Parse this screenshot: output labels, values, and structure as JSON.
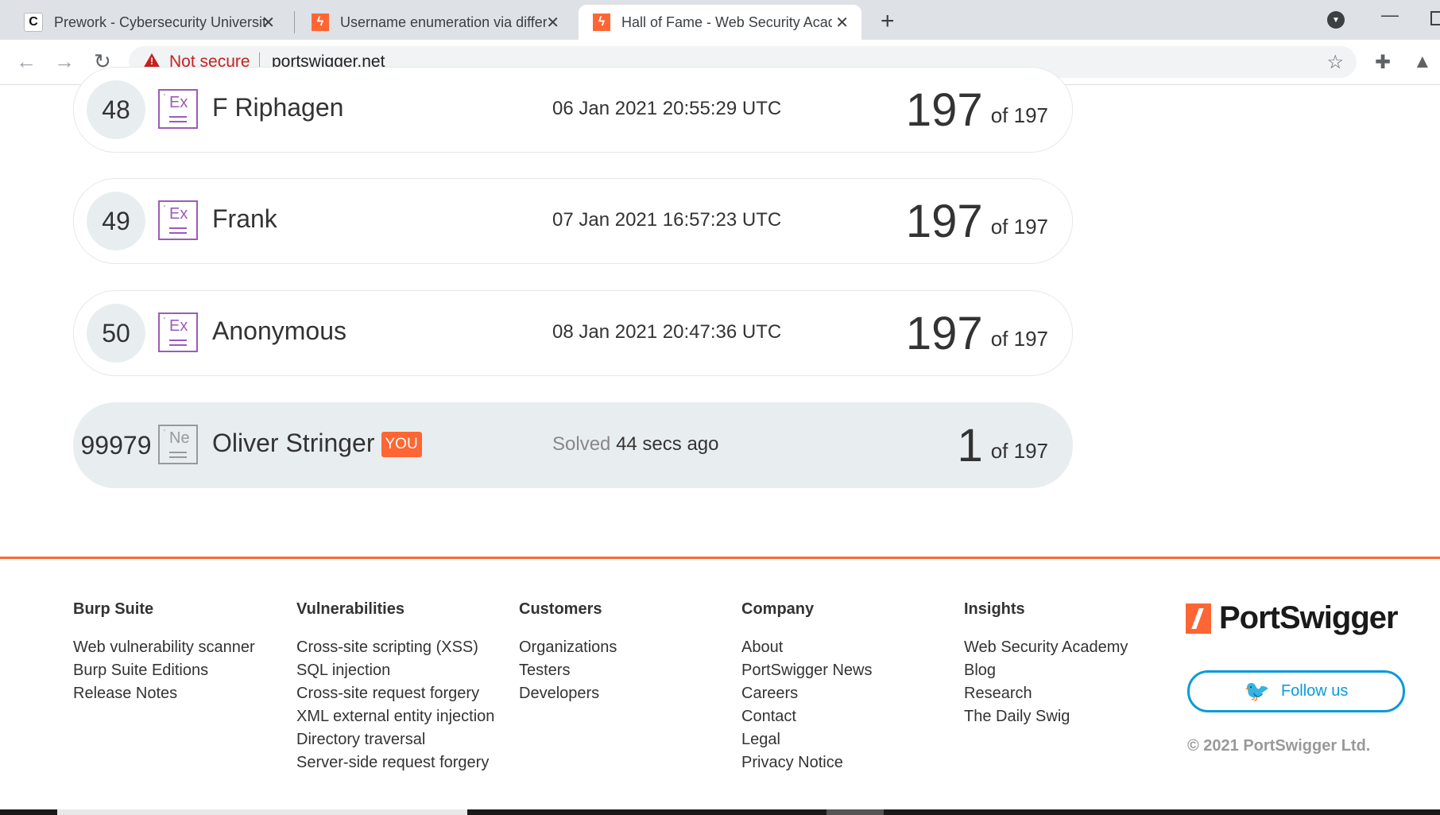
{
  "browser": {
    "tabs": [
      {
        "title": "Prework - Cybersecurity Universit",
        "favicon": "c-logo-icon"
      },
      {
        "title": "Username enumeration via differ",
        "favicon": "portswigger-icon"
      },
      {
        "title": "Hall of Fame - Web Security Acad",
        "favicon": "portswigger-icon"
      }
    ],
    "not_secure": "Not secure",
    "url": "portswigger.net"
  },
  "leaderboard": [
    {
      "rank": "48",
      "badge": "Ex",
      "name": "F Riphagen",
      "date": "06 Jan 2021 20:55:29 UTC",
      "solved": "197",
      "total": "of 197"
    },
    {
      "rank": "49",
      "badge": "Ex",
      "name": "Frank",
      "date": "07 Jan 2021 16:57:23 UTC",
      "solved": "197",
      "total": "of 197"
    },
    {
      "rank": "50",
      "badge": "Ex",
      "name": "Anonymous",
      "date": "08 Jan 2021 20:47:36 UTC",
      "solved": "197",
      "total": "of 197"
    }
  ],
  "me": {
    "rank": "99979",
    "badge": "Ne",
    "name": "Oliver Stringer",
    "you": "YOU",
    "solved_label": "Solved",
    "solved_ago": "44 secs ago",
    "solved": "1",
    "total": "of 197"
  },
  "footer": {
    "columns": [
      {
        "title": "Burp Suite",
        "links": [
          "Web vulnerability scanner",
          "Burp Suite Editions",
          "Release Notes"
        ]
      },
      {
        "title": "Vulnerabilities",
        "links": [
          "Cross-site scripting (XSS)",
          "SQL injection",
          "Cross-site request forgery",
          "XML external entity injection",
          "Directory traversal",
          "Server-side request forgery"
        ]
      },
      {
        "title": "Customers",
        "links": [
          "Organizations",
          "Testers",
          "Developers"
        ]
      },
      {
        "title": "Company",
        "links": [
          "About",
          "PortSwigger News",
          "Careers",
          "Contact",
          "Legal",
          "Privacy Notice"
        ]
      },
      {
        "title": "Insights",
        "links": [
          "Web Security Academy",
          "Blog",
          "Research",
          "The Daily Swig"
        ]
      }
    ],
    "logo_text": "PortSwigger",
    "follow": "Follow us",
    "copyright": "© 2021 PortSwigger Ltd."
  },
  "colors": {
    "accent": "#ff6633",
    "twitter": "#0b9adb",
    "expert_badge": "#9c5bb8"
  }
}
